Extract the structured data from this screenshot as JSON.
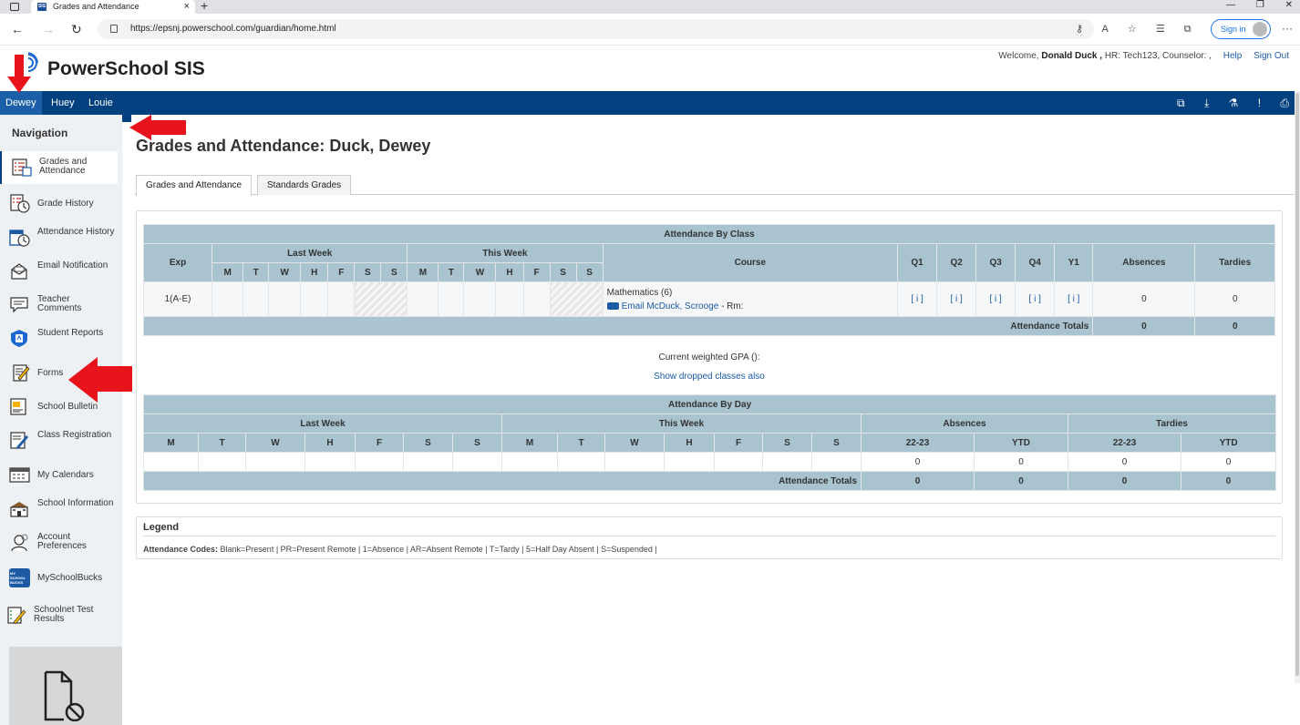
{
  "browser": {
    "tab_title": "Grades and Attendance",
    "favicon_text": "SIS",
    "url": "https://epsnj.powerschool.com/guardian/home.html",
    "signin_label": "Sign in"
  },
  "header": {
    "logo_text": "PowerSchool SIS",
    "welcome_prefix": "Welcome,",
    "user_name": "Donald Duck ,",
    "hr_text": "HR: Tech123, Counselor: ,",
    "help_label": "Help",
    "signout_label": "Sign Out"
  },
  "students": [
    "Dewey",
    "Huey",
    "Louie"
  ],
  "navigation": {
    "title": "Navigation",
    "items": [
      {
        "label": "Grades and Attendance",
        "icon": "grades-icon"
      },
      {
        "label": "Grade History",
        "icon": "grade-history-icon"
      },
      {
        "label": "Attendance History",
        "icon": "attendance-history-icon"
      },
      {
        "label": "Email Notification",
        "icon": "email-icon"
      },
      {
        "label": "Teacher Comments",
        "icon": "comments-icon"
      },
      {
        "label": "Student Reports",
        "icon": "reports-icon"
      },
      {
        "label": "Forms",
        "icon": "forms-icon"
      },
      {
        "label": "School Bulletin",
        "icon": "bulletin-icon"
      },
      {
        "label": "Class Registration",
        "icon": "registration-icon"
      },
      {
        "label": "My Calendars",
        "icon": "calendar-icon"
      },
      {
        "label": "School Information",
        "icon": "school-icon"
      },
      {
        "label": "Account Preferences",
        "icon": "preferences-icon"
      },
      {
        "label": "MySchoolBucks",
        "icon": "myschoolbucks-icon"
      },
      {
        "label": "Schoolnet Test Results",
        "icon": "test-results-icon"
      }
    ],
    "msb_icon_text": "MY SCHOOL BUCKS"
  },
  "page": {
    "title": "Grades and Attendance: Duck, Dewey",
    "tabs": [
      "Grades and Attendance",
      "Standards Grades"
    ]
  },
  "attendance_by_class": {
    "title": "Attendance By Class",
    "col_exp": "Exp",
    "col_last_week": "Last Week",
    "col_this_week": "This Week",
    "days": [
      "M",
      "T",
      "W",
      "H",
      "F",
      "S",
      "S"
    ],
    "col_course": "Course",
    "terms": [
      "Q1",
      "Q2",
      "Q3",
      "Q4",
      "Y1"
    ],
    "col_absences": "Absences",
    "col_tardies": "Tardies",
    "row": {
      "exp": "1(A-E)",
      "course": "Mathematics (6)",
      "email_label": "Email McDuck, Scrooge",
      "room": "- Rm:",
      "grade_cell": "[ i ]",
      "absences": "0",
      "tardies": "0"
    },
    "totals_label": "Attendance Totals",
    "total_absences": "0",
    "total_tardies": "0"
  },
  "gpa_text": "Current weighted GPA ():",
  "dropped_link": "Show dropped classes also",
  "attendance_by_day": {
    "title": "Attendance By Day",
    "col_last_week": "Last Week",
    "col_this_week": "This Week",
    "col_absences": "Absences",
    "col_tardies": "Tardies",
    "days": [
      "M",
      "T",
      "W",
      "H",
      "F",
      "S",
      "S"
    ],
    "sub": [
      "22-23",
      "YTD",
      "22-23",
      "YTD"
    ],
    "row_values": [
      "0",
      "0",
      "0",
      "0"
    ],
    "totals_label": "Attendance Totals",
    "totals_values": [
      "0",
      "0",
      "0",
      "0"
    ]
  },
  "legend": {
    "title": "Legend",
    "codes_label": "Attendance Codes:",
    "codes_text": "Blank=Present | PR=Present Remote | 1=Absence | AR=Absent Remote | T=Tardy | 5=Half Day Absent | S=Suspended |"
  },
  "colors": {
    "student_bar": "#02417f",
    "table_header": "#a9c4d0",
    "link": "#1c5aa6",
    "annotation_arrow": "#e8141c"
  }
}
